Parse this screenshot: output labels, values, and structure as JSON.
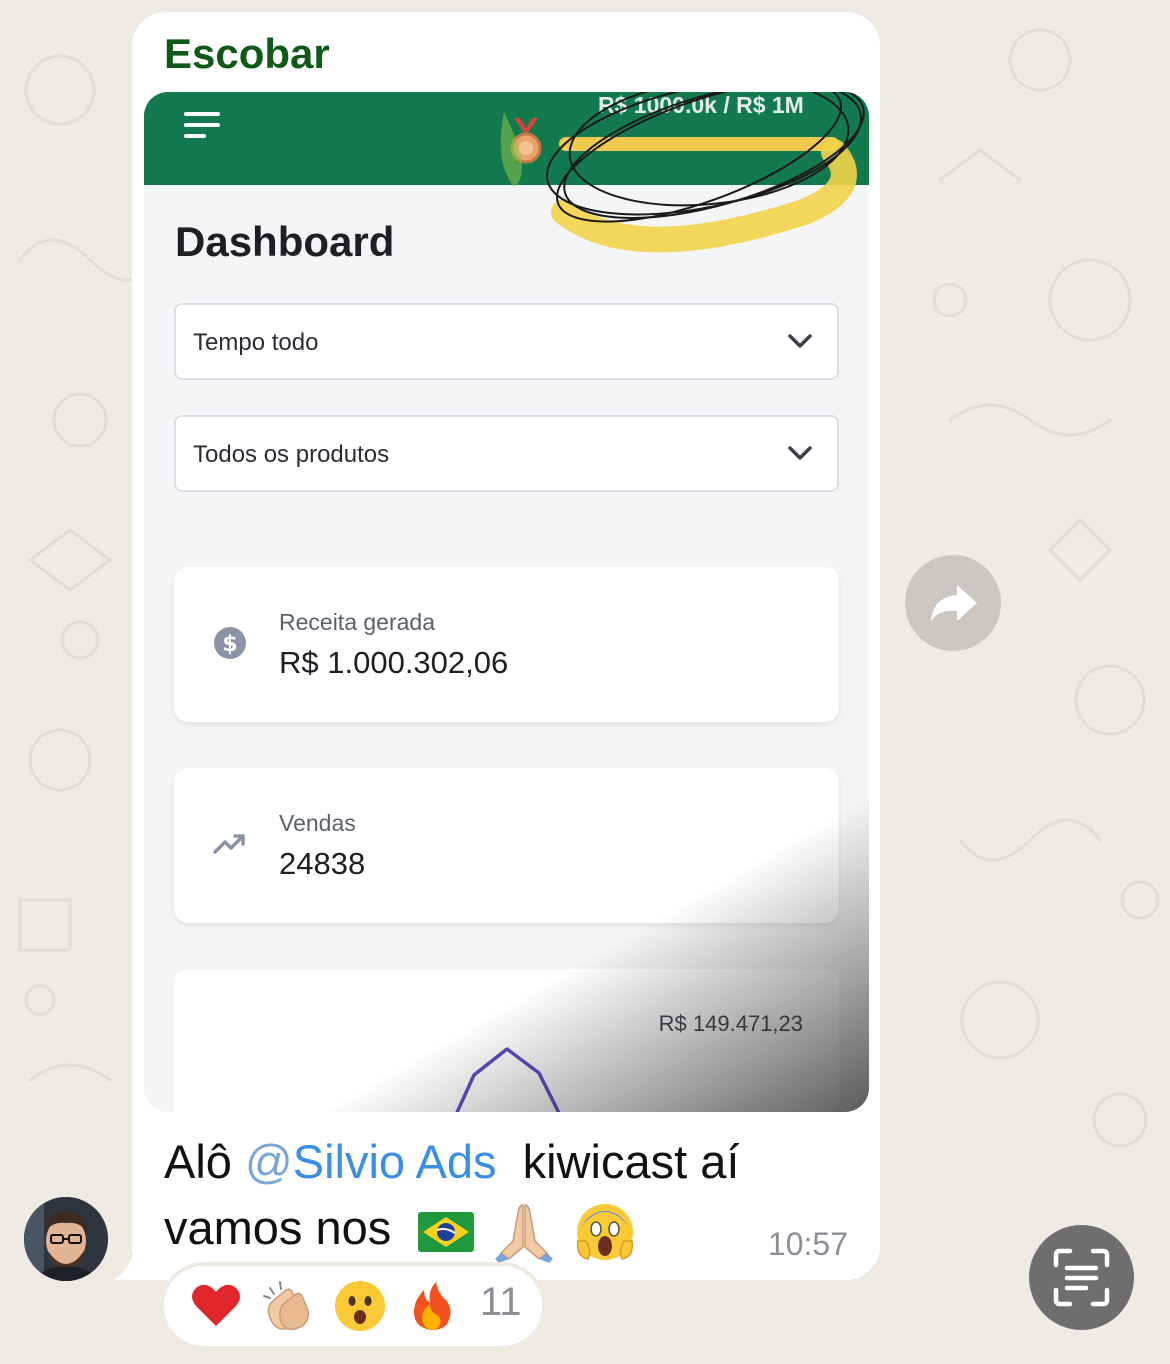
{
  "chat": {
    "sender_name": "Escobar",
    "message": {
      "text_before": "Alô ",
      "mention_at": "@",
      "mention_name": "Silvio Ads",
      "text_after": "  kiwicast aí",
      "line2_text": "vamos nos",
      "emoji_icons": [
        "brazil-flag-icon",
        "folded-hands-icon",
        "screaming-face-icon"
      ],
      "time": "10:57"
    },
    "reactions": {
      "items": [
        "red-heart-icon",
        "clapping-hands-icon",
        "surprised-face-icon",
        "fire-icon"
      ],
      "count": "11"
    },
    "colors": {
      "sender_name": "#0f5a16",
      "mention": "#3a8ee8",
      "bubble": "#ffffff",
      "background": "#efeae2"
    }
  },
  "screenshot": {
    "header": {
      "goal_text": "R$ 1000.0k / R$ 1M",
      "progress": 1.0,
      "color": "#137a4f"
    },
    "title": "Dashboard",
    "filters": [
      {
        "label": "Tempo todo"
      },
      {
        "label": "Todos os produtos"
      }
    ],
    "cards": [
      {
        "label": "Receita gerada",
        "value": "R$  1.000.302,06",
        "icon": "dollar-circle-icon"
      },
      {
        "label": "Vendas",
        "value": "24838",
        "icon": "trending-up-icon"
      }
    ],
    "chart": {
      "peak_label": "R$  149.471,23"
    }
  }
}
